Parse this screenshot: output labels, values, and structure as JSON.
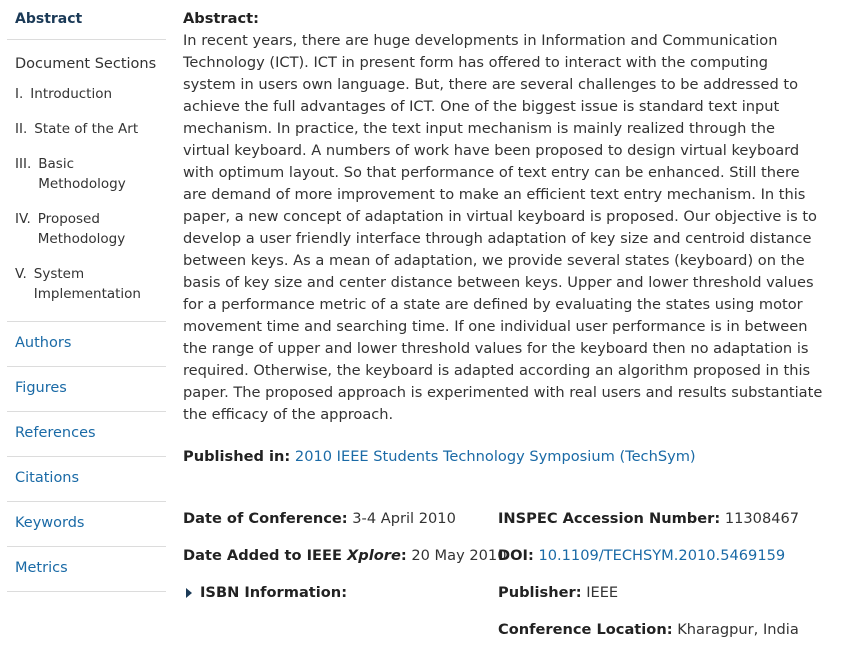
{
  "sidebar": {
    "active_item": "Abstract",
    "document_sections_label": "Document Sections",
    "sections": [
      {
        "num": "I.",
        "label": "Introduction"
      },
      {
        "num": "II.",
        "label": "State of the Art"
      },
      {
        "num": "III.",
        "label": "Basic Methodology"
      },
      {
        "num": "IV.",
        "label": "Proposed Methodology"
      },
      {
        "num": "V.",
        "label": "System Implementation"
      }
    ],
    "links": [
      "Authors",
      "Figures",
      "References",
      "Citations",
      "Keywords",
      "Metrics"
    ]
  },
  "abstract": {
    "title": "Abstract:",
    "text": "In recent years, there are huge developments in Information and Communication Technology (ICT). ICT in present form has offered to interact with the computing system in users own language. But, there are several challenges to be addressed to achieve the full advantages of ICT. One of the biggest issue is standard text input mechanism. In practice, the text input mechanism is mainly realized through the virtual keyboard. A numbers of work have been proposed to design virtual keyboard with optimum layout. So that performance of text entry can be enhanced. Still there are demand of more improvement to make an efficient text entry mechanism. In this paper, a new concept of adaptation in virtual keyboard is proposed. Our objective is to develop a user friendly interface through adaptation of key size and centroid distance between keys. As a mean of adaptation, we provide several states (keyboard) on the basis of key size and center distance between keys. Upper and lower threshold values for a performance metric of a state are defined by evaluating the states using motor movement time and searching time. If one individual user performance is in between the range of upper and lower threshold values for the keyboard then no adaptation is required. Otherwise, the keyboard is adapted according an algorithm proposed in this paper. The proposed approach is experimented with real users and results substantiate the efficacy of the approach."
  },
  "published_in": {
    "label": "Published in:",
    "value": "2010 IEEE Students Technology Symposium (TechSym)"
  },
  "metadata": {
    "date_of_conference": {
      "label": "Date of Conference:",
      "value": "3-4 April 2010"
    },
    "date_added": {
      "label_prefix": "Date Added to IEEE ",
      "label_italic": "Xplore",
      "label_suffix": ":",
      "value": "20 May 2010"
    },
    "isbn": {
      "label": "ISBN Information:"
    },
    "inspec": {
      "label": "INSPEC Accession Number:",
      "value": "11308467"
    },
    "doi": {
      "label": "DOI:",
      "value": "10.1109/TECHSYM.2010.5469159"
    },
    "publisher": {
      "label": "Publisher:",
      "value": "IEEE"
    },
    "conference_location": {
      "label": "Conference Location:",
      "value": "Kharagpur, India"
    }
  },
  "colors": {
    "link": "#1a6aa6",
    "active_nav": "#1b3a57",
    "divider": "#dcdcdc",
    "text": "#333333"
  }
}
